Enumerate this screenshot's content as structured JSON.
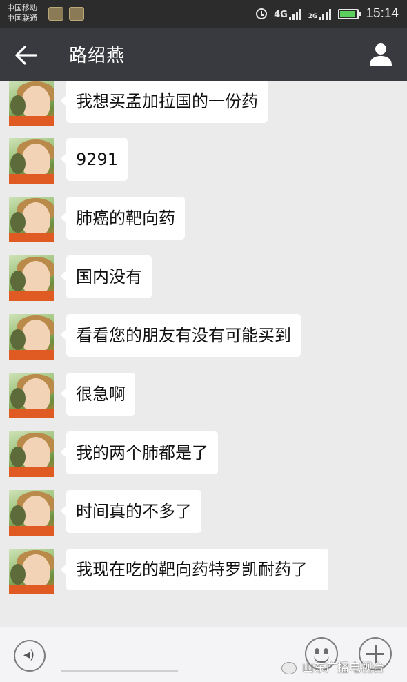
{
  "status_bar": {
    "carrier_1": "中国移动",
    "carrier_2": "中国联通",
    "net_1": "4G",
    "net_2_top": "4G",
    "net_3": "2G",
    "time": "15:14",
    "battery_color": "#5cd05c"
  },
  "header": {
    "title": "路绍燕",
    "back_icon": "back-arrow-icon",
    "profile_icon": "profile-icon"
  },
  "messages": [
    {
      "text": "我想买孟加拉国的一份药"
    },
    {
      "text": "9291"
    },
    {
      "text": "肺癌的靶向药"
    },
    {
      "text": "国内没有"
    },
    {
      "text": "看看您的朋友有没有可能买到"
    },
    {
      "text": "很急啊"
    },
    {
      "text": "我的两个肺都是了"
    },
    {
      "text": "时间真的不多了"
    },
    {
      "text": "我现在吃的靶向药特罗凯耐药了"
    }
  ],
  "input_bar": {
    "voice_icon": "voice-icon",
    "emoji_icon": "emoji-icon",
    "plus_icon": "plus-icon"
  },
  "watermark": {
    "text": "山东广播电视台"
  }
}
